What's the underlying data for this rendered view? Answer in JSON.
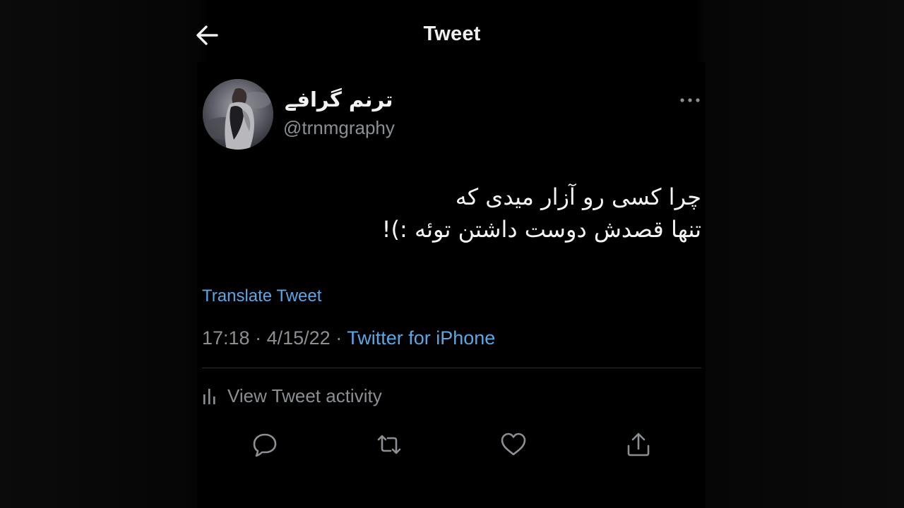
{
  "header": {
    "title": "Tweet",
    "back_icon": "arrow-left-icon"
  },
  "tweet": {
    "author": {
      "display_name": "ترنم گرافے",
      "handle": "@trnmgraphy",
      "avatar_icon": "avatar-photo"
    },
    "more_icon": "more-horizontal-icon",
    "text_lines": [
      "چرا کسی رو آزار میدی که",
      "تنها قصدش دوست داشتن توئه :)!"
    ],
    "translate_label": "Translate Tweet",
    "time": "17:18",
    "separator": "·",
    "date": "4/15/22",
    "source": "Twitter for iPhone",
    "activity_label": "View Tweet activity",
    "activity_icon": "bar-chart-icon"
  },
  "actions": [
    {
      "name": "reply",
      "icon": "reply-icon"
    },
    {
      "name": "retweet",
      "icon": "retweet-icon"
    },
    {
      "name": "like",
      "icon": "heart-icon"
    },
    {
      "name": "share",
      "icon": "share-icon"
    }
  ],
  "colors": {
    "background": "#000000",
    "text": "#e7e9ea",
    "secondary_text": "#8b8f94",
    "link": "#5aa7e6",
    "divider": "#2a2d31"
  }
}
